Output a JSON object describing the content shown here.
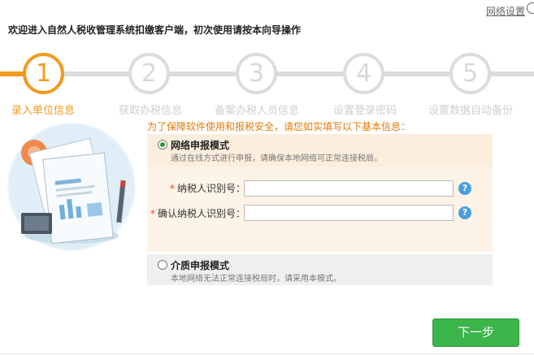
{
  "header": {
    "network_settings_label": "网络设置",
    "welcome_text": "欢迎进入自然人税收管理系统扣缴客户端，初次使用请按本向导操作"
  },
  "steps": [
    {
      "number": "1",
      "label": "录入单位信息",
      "active": true
    },
    {
      "number": "2",
      "label": "获取办税信息",
      "active": false
    },
    {
      "number": "3",
      "label": "备案办税人员信息",
      "active": false
    },
    {
      "number": "4",
      "label": "设置登录密码",
      "active": false
    },
    {
      "number": "5",
      "label": "设置数据自动备份",
      "active": false
    }
  ],
  "notice": "为了保障软件使用和报税安全，请您如实填写以下基本信息：",
  "online_mode": {
    "title": "网络申报模式",
    "desc": "通过在线方式进行申报，请确保本地网络可正常连接税局。",
    "selected": true,
    "fields": [
      {
        "label": "纳税人识别号：",
        "value": ""
      },
      {
        "label": "确认纳税人识别号：",
        "value": ""
      }
    ],
    "help_glyph": "?"
  },
  "media_mode": {
    "title": "介质申报模式",
    "desc": "本地网络无法正常连接税局时，请采用本模式。",
    "selected": false
  },
  "footer": {
    "next_label": "下一步"
  },
  "colors": {
    "accent_orange": "#f29a1d",
    "primary_green": "#3bb44a",
    "help_blue": "#4a9ee0"
  }
}
